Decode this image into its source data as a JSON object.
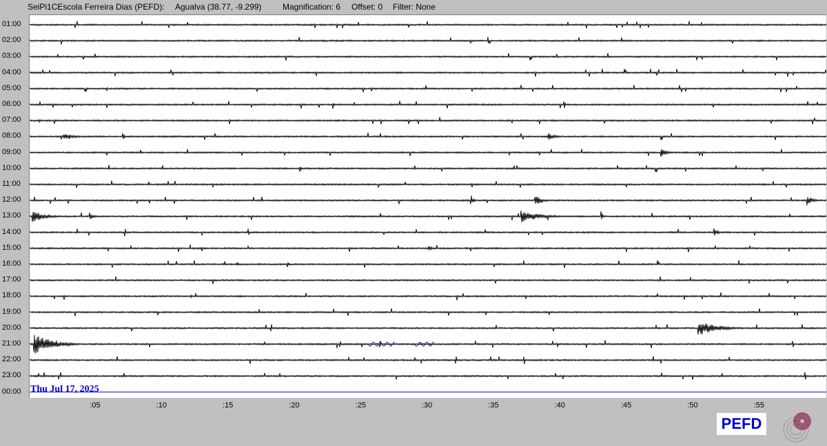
{
  "header": {
    "station": "SeiPi1CEscola Ferreira Dias (PEFD):",
    "location": "Agualva (38.77, -9.299)",
    "magnification": "Magnification: 6",
    "offset": "Offset: 0",
    "filter": "Filter: None"
  },
  "hours": [
    "01:00",
    "02:00",
    "03:00",
    "04:00",
    "05:00",
    "06:00",
    "07:00",
    "08:00",
    "09:00",
    "10:00",
    "11:00",
    "12:00",
    "13:00",
    "14:00",
    "15:00",
    "16:00",
    "17:00",
    "18:00",
    "19:00",
    "20:00",
    "21:00",
    "22:00",
    "23:00",
    "00:00"
  ],
  "minute_ticks": [
    ":05",
    ":10",
    ":15",
    ":20",
    ":25",
    ":30",
    ":35",
    ":40",
    ":45",
    ":50",
    ":55"
  ],
  "date": "Thu Jul 17, 2025",
  "logo": {
    "text": "PEFD"
  },
  "colors": {
    "trace": "#000000",
    "blue_trace": "#0000cc",
    "blue_wave": "#1a2a8a",
    "logo_text": "#0000cc",
    "logo_mark": "#cc2222"
  },
  "events": [
    {
      "hour_index": 4,
      "minute": 5.8,
      "amp": 4,
      "dur": 0.3
    },
    {
      "hour_index": 5,
      "minute": 22.8,
      "amp": 12,
      "dur": 0.3
    },
    {
      "hour_index": 5,
      "minute": 40.2,
      "amp": 12,
      "dur": 0.3
    },
    {
      "hour_index": 6,
      "minute": 0.7,
      "amp": 7,
      "dur": 0.2
    },
    {
      "hour_index": 7,
      "minute": 2.5,
      "amp": 5,
      "dur": 2.5
    },
    {
      "hour_index": 7,
      "minute": 7.0,
      "amp": 9,
      "dur": 0.3
    },
    {
      "hour_index": 7,
      "minute": 39.0,
      "amp": 6,
      "dur": 1.5
    },
    {
      "hour_index": 8,
      "minute": 47.5,
      "amp": 8,
      "dur": 1.2
    },
    {
      "hour_index": 9,
      "minute": 20.3,
      "amp": 9,
      "dur": 0.3
    },
    {
      "hour_index": 11,
      "minute": 33.2,
      "amp": 10,
      "dur": 0.6
    },
    {
      "hour_index": 11,
      "minute": 38.0,
      "amp": 9,
      "dur": 1.5
    },
    {
      "hour_index": 11,
      "minute": 58.5,
      "amp": 9,
      "dur": 1.2
    },
    {
      "hour_index": 12,
      "minute": 0.2,
      "amp": 9,
      "dur": 2.8
    },
    {
      "hour_index": 12,
      "minute": 4.5,
      "amp": 6,
      "dur": 0.8
    },
    {
      "hour_index": 12,
      "minute": 37.0,
      "amp": 9,
      "dur": 4.5
    },
    {
      "hour_index": 12,
      "minute": 43.0,
      "amp": 9,
      "dur": 0.5
    },
    {
      "hour_index": 13,
      "minute": 51.5,
      "amp": 7,
      "dur": 1.0
    },
    {
      "hour_index": 14,
      "minute": 30.0,
      "amp": 4,
      "dur": 1.0
    },
    {
      "hour_index": 15,
      "minute": 15.6,
      "amp": 6,
      "dur": 0.3
    },
    {
      "hour_index": 15,
      "minute": 19.4,
      "amp": 6,
      "dur": 0.4
    },
    {
      "hour_index": 17,
      "minute": 12.1,
      "amp": 7,
      "dur": 0.2
    },
    {
      "hour_index": 19,
      "minute": 50.3,
      "amp": 12,
      "dur": 4.0
    },
    {
      "hour_index": 20,
      "minute": 0.3,
      "amp": 16,
      "dur": 4.0
    }
  ],
  "blue_waves": [
    {
      "hour_index": 20,
      "start_minute": 25.5,
      "end_minute": 27.5
    },
    {
      "hour_index": 20,
      "start_minute": 29.0,
      "end_minute": 30.5
    }
  ]
}
